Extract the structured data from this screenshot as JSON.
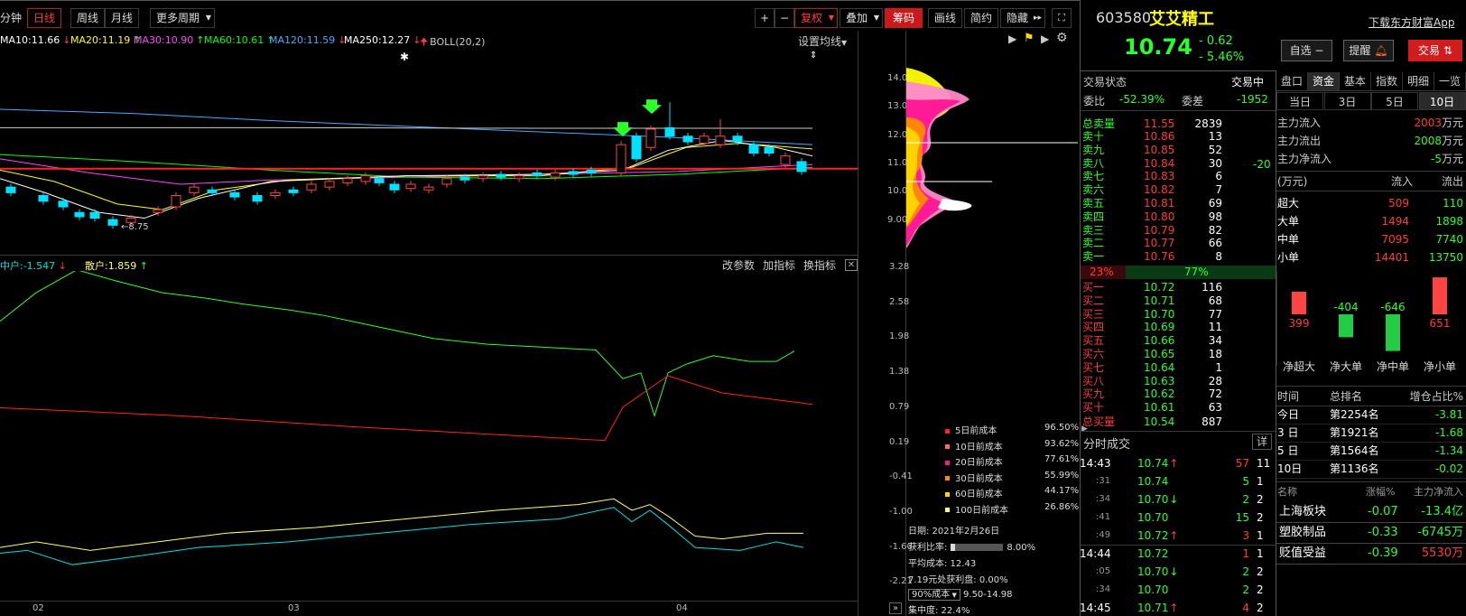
{
  "toolbar": {
    "minute_label": "分钟",
    "tabs": [
      "日线",
      "周线",
      "月线",
      "更多周期"
    ],
    "right_buttons": [
      "复权",
      "叠加",
      "筹码",
      "画线",
      "简约",
      "隐藏"
    ],
    "plus": "+",
    "minus": "−"
  },
  "ma_legend": [
    {
      "label": "MA10:11.66",
      "arrow": "↓",
      "color": "#ffffff"
    },
    {
      "label": "MA20:11.19",
      "arrow": "↑",
      "color": "#ffff00"
    },
    {
      "label": "MA30:10.90",
      "arrow": "↑",
      "color": "#ff44ff"
    },
    {
      "label": "MA60:10.61",
      "arrow": "↑",
      "color": "#00ff00"
    },
    {
      "label": "MA120:11.59",
      "arrow": "↓",
      "color": "#44aaff"
    },
    {
      "label": "MA250:12.27",
      "arrow": "↓",
      "color": "#ffffff"
    },
    {
      "label": "BOLL(20,2)",
      "arrow": "",
      "color": "#cccccc"
    }
  ],
  "ma_settings_label": "设置均线",
  "price_axis": [
    "14.00",
    "13.00",
    "12.00",
    "11.00",
    "10.00",
    "9.00"
  ],
  "low_marker": "8.75",
  "indicator": {
    "legend_mid": "中户:-1.547",
    "legend_retail": "散户:1.859",
    "buttons": [
      "改参数",
      "加指标",
      "换指标"
    ],
    "axis": [
      "3.28",
      "2.58",
      "1.98",
      "1.38",
      "0.79",
      "0.19",
      "-0.41",
      "-1.00",
      "-1.60",
      "-2.21"
    ]
  },
  "x_labels": [
    "02",
    "03",
    "04"
  ],
  "chip": {
    "legend": [
      {
        "label": "5日前成本",
        "pct": "96.50%",
        "color": "#ff2222"
      },
      {
        "label": "10日前成本",
        "pct": "93.62%",
        "color": "#ff6666"
      },
      {
        "label": "20日前成本",
        "pct": "77.61%",
        "color": "#ff1493"
      },
      {
        "label": "30日前成本",
        "pct": "55.99%",
        "color": "#ff8c00"
      },
      {
        "label": "60日前成本",
        "pct": "44.17%",
        "color": "#ffd700"
      },
      {
        "label": "100日前成本",
        "pct": "26.86%",
        "color": "#ffff66"
      }
    ],
    "date": "日期: 2021年2月26日",
    "profit_label": "获利比率:",
    "profit_value": "8.00%",
    "avg_cost": "平均成本: 12.43",
    "profit_at": "7.19元处获利盘: 0.00%",
    "cost_select": "90%成本",
    "cost_range": "9.50-14.98",
    "concentration": "集中度: 22.4%"
  },
  "quote": {
    "code": "603580",
    "name": "艾艾精工",
    "download": "下载东方财富App",
    "price": "10.74",
    "change": "- 0.62",
    "change_pct": "- 5.46%",
    "btn_watch": "自选 −",
    "btn_alert": "提醒",
    "btn_trade": "交易"
  },
  "status": {
    "label": "交易状态",
    "value": "交易中",
    "webi_label": "委比",
    "webi_value": "-52.39%",
    "wecha_label": "委差",
    "wecha_value": "-1952"
  },
  "sell": {
    "total_label": "总卖量",
    "total_price": "11.55",
    "total_vol": "2839",
    "rows": [
      {
        "l": "卖十",
        "p": "10.86",
        "v": "13"
      },
      {
        "l": "卖九",
        "p": "10.85",
        "v": "52"
      },
      {
        "l": "卖八",
        "p": "10.84",
        "v": "30"
      },
      {
        "l": "卖七",
        "p": "10.83",
        "v": "6"
      },
      {
        "l": "卖六",
        "p": "10.82",
        "v": "7"
      },
      {
        "l": "卖五",
        "p": "10.81",
        "v": "69"
      },
      {
        "l": "卖四",
        "p": "10.80",
        "v": "98"
      },
      {
        "l": "卖三",
        "p": "10.79",
        "v": "82"
      },
      {
        "l": "卖二",
        "p": "10.77",
        "v": "66"
      },
      {
        "l": "卖一",
        "p": "10.76",
        "v": "8"
      }
    ],
    "delta": "-20"
  },
  "ratio": {
    "left": "23%",
    "right": "77%",
    "fraction": 0.23
  },
  "buy": {
    "rows": [
      {
        "l": "买一",
        "p": "10.72",
        "v": "116"
      },
      {
        "l": "买二",
        "p": "10.71",
        "v": "68"
      },
      {
        "l": "买三",
        "p": "10.70",
        "v": "77"
      },
      {
        "l": "买四",
        "p": "10.69",
        "v": "11"
      },
      {
        "l": "买五",
        "p": "10.66",
        "v": "34"
      },
      {
        "l": "买六",
        "p": "10.65",
        "v": "18"
      },
      {
        "l": "买七",
        "p": "10.64",
        "v": "1"
      },
      {
        "l": "买八",
        "p": "10.63",
        "v": "28"
      },
      {
        "l": "买九",
        "p": "10.62",
        "v": "72"
      },
      {
        "l": "买十",
        "p": "10.61",
        "v": "63"
      }
    ],
    "total_label": "总买量",
    "total_price": "10.54",
    "total_vol": "887"
  },
  "ticks": {
    "title": "分时成交",
    "detail_btn": "详",
    "rows": [
      {
        "t": "14:43",
        "p": "10.74",
        "a": "↑",
        "ac": "red",
        "v": "57",
        "vc": "red",
        "c": "11"
      },
      {
        "t": ":31",
        "p": "10.74",
        "a": "",
        "ac": "",
        "v": "5",
        "vc": "green",
        "c": "1"
      },
      {
        "t": ":34",
        "p": "10.70",
        "a": "↓",
        "ac": "green",
        "v": "2",
        "vc": "green",
        "c": "2"
      },
      {
        "t": ":41",
        "p": "10.70",
        "a": "",
        "ac": "",
        "v": "15",
        "vc": "green",
        "c": "2"
      },
      {
        "t": ":49",
        "p": "10.72",
        "a": "↑",
        "ac": "red",
        "v": "3",
        "vc": "red",
        "c": "1"
      },
      {
        "t": "14:44",
        "p": "10.72",
        "a": "",
        "ac": "",
        "v": "1",
        "vc": "red",
        "c": "1"
      },
      {
        "t": ":05",
        "p": "10.70",
        "a": "↓",
        "ac": "green",
        "v": "2",
        "vc": "green",
        "c": "2"
      },
      {
        "t": ":34",
        "p": "10.70",
        "a": "",
        "ac": "",
        "v": "2",
        "vc": "green",
        "c": "2"
      },
      {
        "t": "14:45",
        "p": "10.71",
        "a": "↑",
        "ac": "red",
        "v": "4",
        "vc": "red",
        "c": "2"
      }
    ]
  },
  "right_tabs": [
    "盘口",
    "资金",
    "基本",
    "指数",
    "明细",
    "一览"
  ],
  "period_tabs": [
    "当日",
    "3日",
    "5日",
    "10日"
  ],
  "flows": [
    {
      "label": "主力流入",
      "value": "2003",
      "unit": "万元",
      "color": "red"
    },
    {
      "label": "主力流出",
      "value": "2008",
      "unit": "万元",
      "color": "green"
    },
    {
      "label": "主力净流入",
      "value": "-5",
      "unit": "万元",
      "color": "green"
    }
  ],
  "flow_table": {
    "header": [
      "(万元)",
      "流入",
      "流出"
    ],
    "rows": [
      {
        "n": "超大",
        "in": "509",
        "out": "110"
      },
      {
        "n": "大单",
        "in": "1494",
        "out": "1898"
      },
      {
        "n": "中单",
        "in": "7095",
        "out": "7740"
      },
      {
        "n": "小单",
        "in": "14401",
        "out": "13750"
      }
    ]
  },
  "net_bars": [
    {
      "label": "净超大",
      "value": 399,
      "text": "399"
    },
    {
      "label": "净大单",
      "value": -404,
      "text": "-404"
    },
    {
      "label": "净中单",
      "value": -646,
      "text": "-646"
    },
    {
      "label": "净小单",
      "value": 651,
      "text": "651"
    }
  ],
  "rank": {
    "header": [
      "时间",
      "总排名",
      "增仓占比%"
    ],
    "rows": [
      {
        "t": "今日",
        "r": "第2254名",
        "v": "-3.81"
      },
      {
        "t": "3 日",
        "r": "第1921名",
        "v": "-1.68"
      },
      {
        "t": "5 日",
        "r": "第1564名",
        "v": "-1.34"
      },
      {
        "t": "10日",
        "r": "第1136名",
        "v": "-0.02"
      }
    ]
  },
  "sectors": {
    "header": [
      "名称",
      "涨幅%",
      "主力净流入"
    ],
    "rows": [
      {
        "n": "上海板块",
        "c": "-0.07",
        "f": "-13.4亿",
        "fc": "green"
      },
      {
        "n": "塑胶制品",
        "c": "-0.33",
        "f": "-6745万",
        "fc": "green"
      },
      {
        "n": "贬值受益",
        "c": "-0.39",
        "f": "5530万",
        "fc": "red"
      }
    ]
  }
}
